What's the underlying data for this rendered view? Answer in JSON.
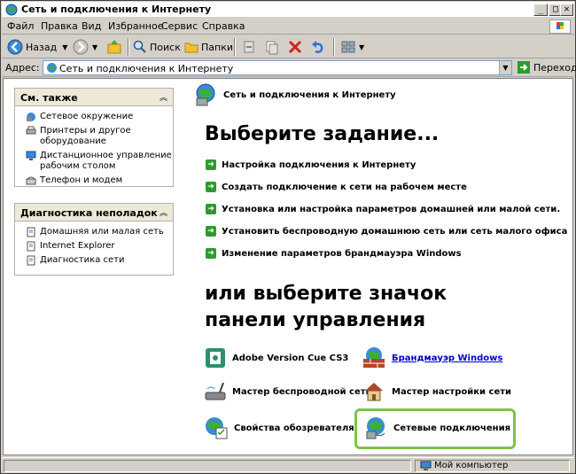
{
  "window": {
    "title": "Сеть и подключения к Интернету"
  },
  "menu": [
    "Файл",
    "Правка",
    "Вид",
    "Избранное",
    "Сервис",
    "Справка"
  ],
  "toolbar": {
    "back": "Назад",
    "search": "Поиск",
    "folders": "Папки"
  },
  "address": {
    "label": "Адрес:",
    "value": "Сеть и подключения к Интернету",
    "go": "Переход"
  },
  "header": {
    "title": "Сеть и подключения к Интернету"
  },
  "see_also": {
    "title": "См. также",
    "items": [
      "Сетевое окружение",
      "Принтеры и другое оборудование",
      "Дистанционное управление рабочим столом",
      "Телефон и модем"
    ]
  },
  "troubleshoot": {
    "title": "Диагностика неполадок",
    "items": [
      "Домашняя или малая сеть",
      "Internet Explorer",
      "Диагностика сети"
    ]
  },
  "main": {
    "pick_task": "Выберите задание...",
    "tasks": [
      "Настройка подключения к Интернету",
      "Создать подключение к сети на рабочем месте",
      "Установка или настройка параметров домашней или малой сети.",
      "Установить беспроводную домашнюю сеть или сеть малого офиса",
      "Изменение параметров брандмауэра Windows"
    ],
    "pick_icon": "или выберите значок панели управления",
    "icons": [
      {
        "label": "Adobe Version Cue CS3",
        "icon": "adobe-cue-icon"
      },
      {
        "label": "Брандмауэр Windows",
        "icon": "firewall-icon"
      },
      {
        "label": "Мастер беспроводной сети",
        "icon": "wireless-icon"
      },
      {
        "label": "Мастер настройки сети",
        "icon": "home-network-icon"
      },
      {
        "label": "Свойства обозревателя",
        "icon": "internet-options-icon"
      },
      {
        "label": "Сетевые подключения",
        "icon": "network-connections-icon"
      }
    ]
  },
  "status": {
    "text": "Мой компьютер"
  }
}
